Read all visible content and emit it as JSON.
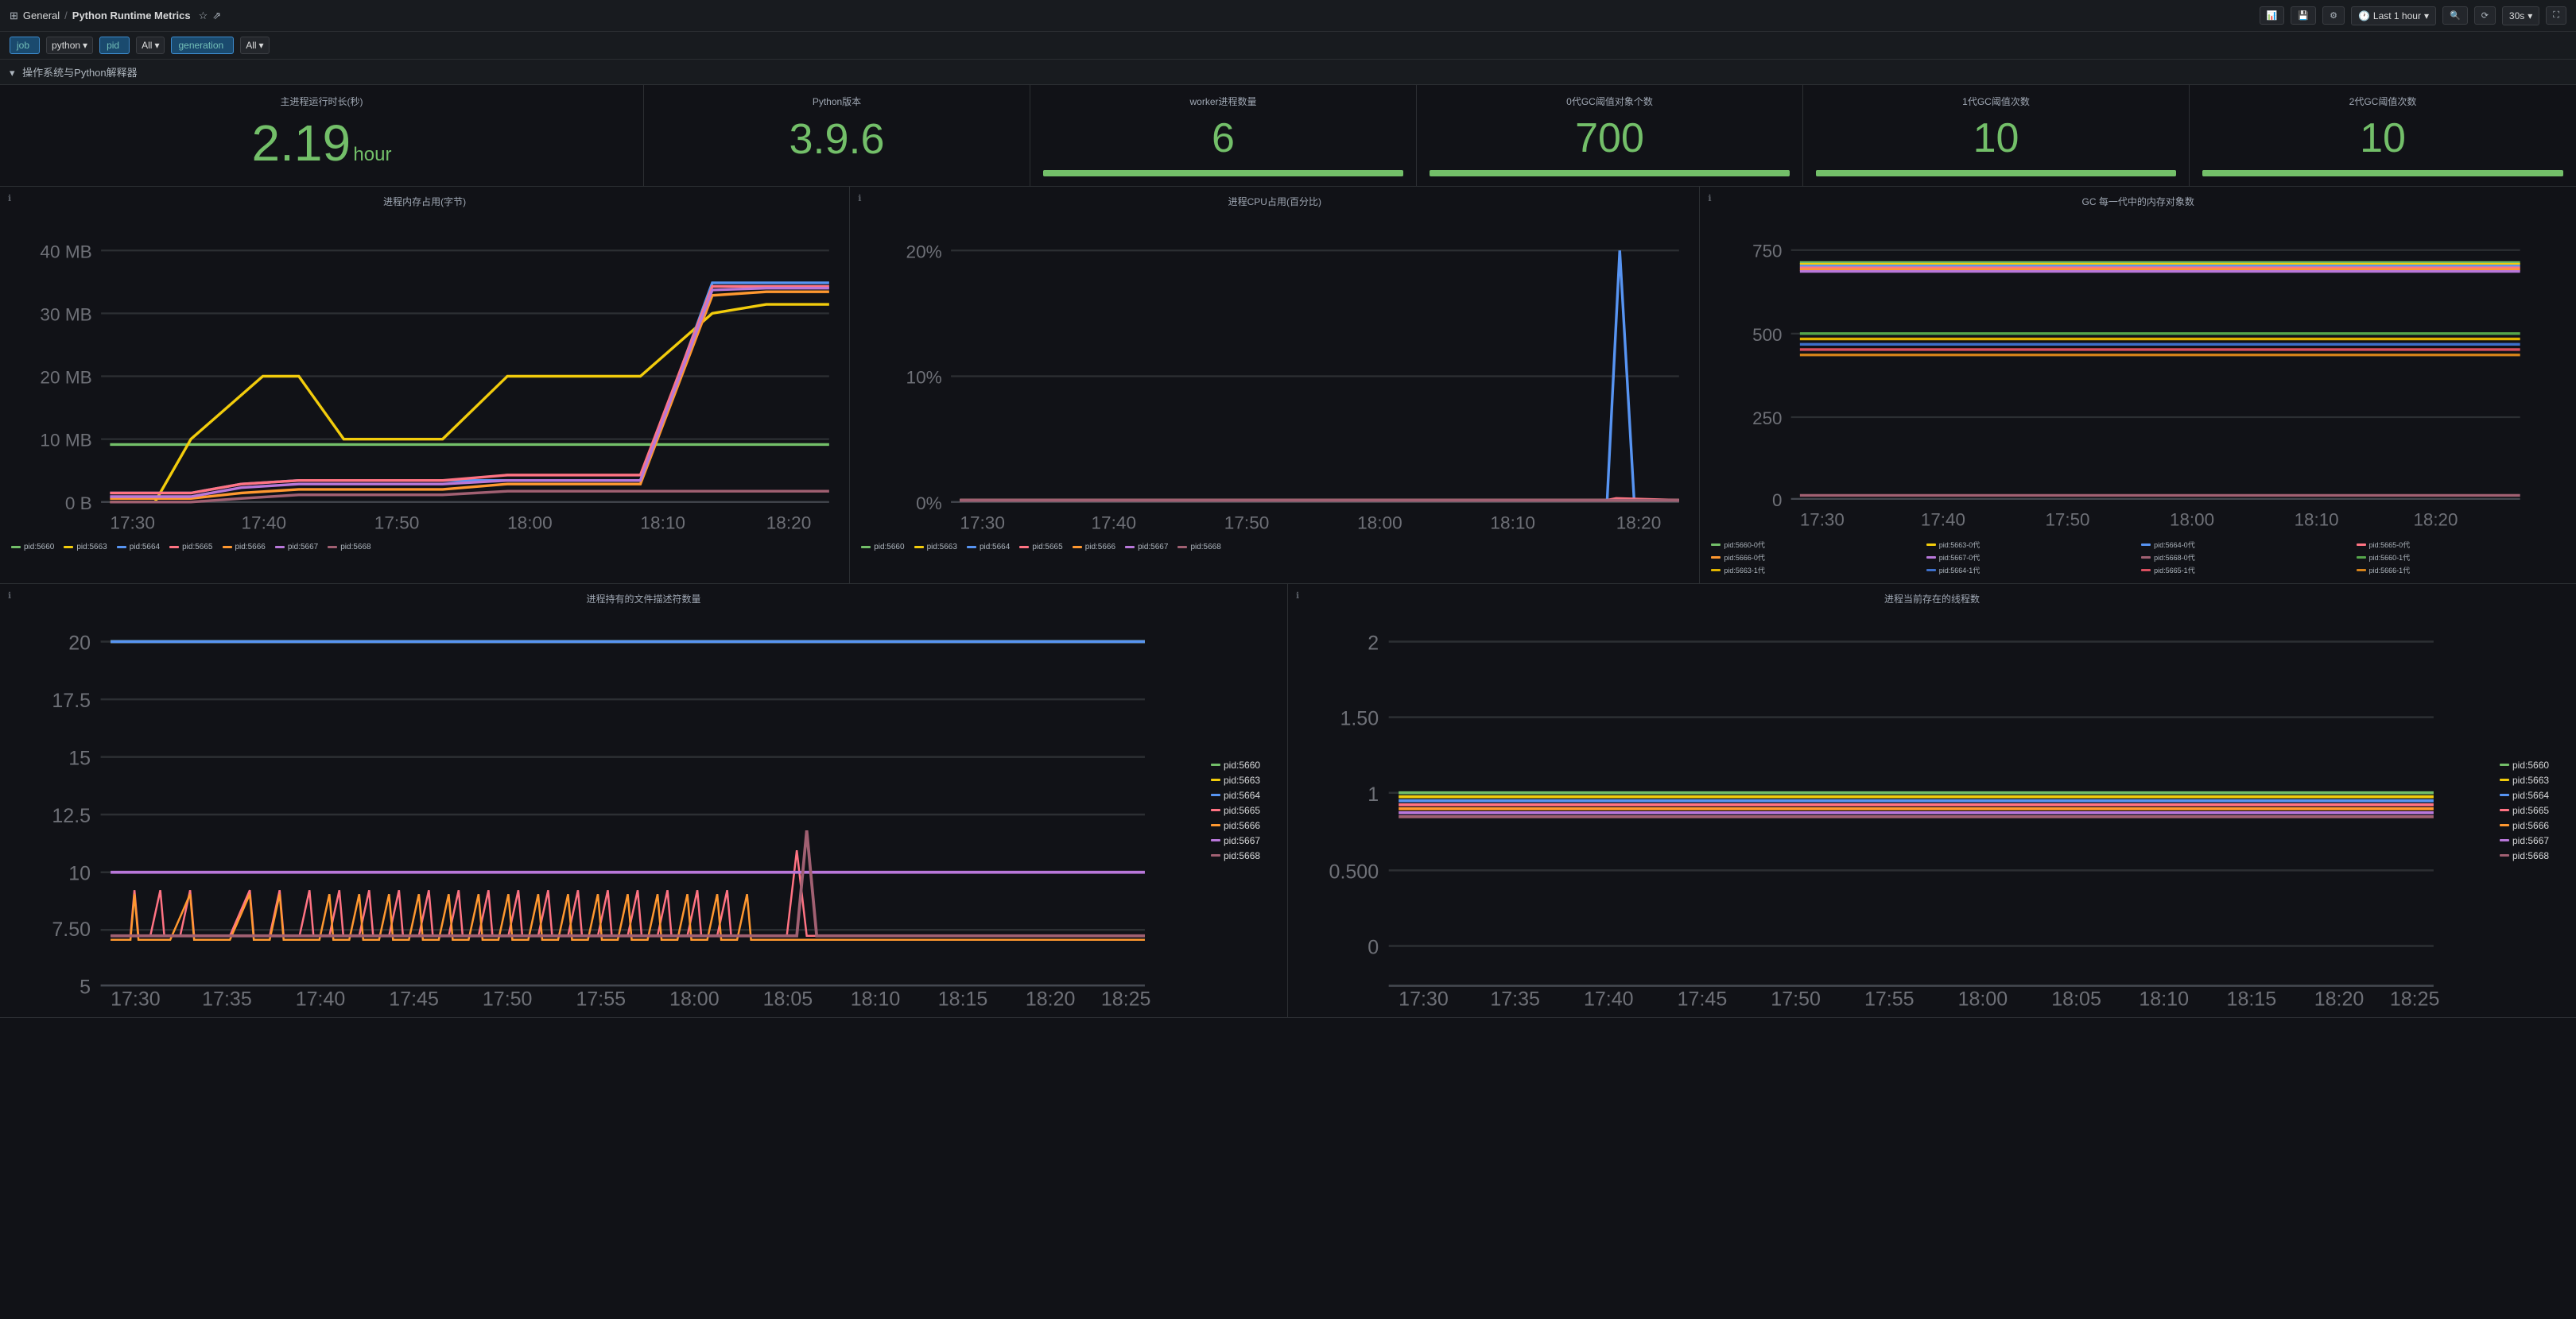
{
  "header": {
    "breadcrumb_home": "General",
    "separator": "/",
    "title": "Python Runtime Metrics",
    "time_label": "Last 1 hour",
    "refresh_label": "30s"
  },
  "filters": [
    {
      "key": "job",
      "value": "",
      "type": "key-only"
    },
    {
      "key": "python",
      "value": "",
      "type": "dropdown"
    },
    {
      "key": "pid",
      "value": "",
      "type": "key-only"
    },
    {
      "key": "All",
      "value": "",
      "type": "plain"
    },
    {
      "key": "generation",
      "value": "",
      "type": "key-only"
    },
    {
      "key": "All",
      "value": "",
      "type": "plain2"
    }
  ],
  "section_title": "操作系统与Python解释器",
  "stats": [
    {
      "label": "主进程运行时长(秒)",
      "value": "2.19",
      "unit": "hour",
      "bar": false
    },
    {
      "label": "Python版本",
      "value": "3.9.6",
      "unit": "",
      "bar": false
    },
    {
      "label": "worker进程数量",
      "value": "6",
      "unit": "",
      "bar": true,
      "bar_pct": 100
    },
    {
      "label": "0代GC阈值对象个数",
      "value": "700",
      "unit": "",
      "bar": true,
      "bar_pct": 100
    },
    {
      "label": "1代GC阈值次数",
      "value": "10",
      "unit": "",
      "bar": true,
      "bar_pct": 100
    },
    {
      "label": "2代GC阈值次数",
      "value": "10",
      "unit": "",
      "bar": true,
      "bar_pct": 100
    }
  ],
  "charts": [
    {
      "id": "mem",
      "title": "进程内存占用(字节)",
      "y_labels": [
        "40 MB",
        "30 MB",
        "20 MB",
        "10 MB",
        "0 B"
      ],
      "x_labels": [
        "17:30",
        "17:40",
        "17:50",
        "18:00",
        "18:10",
        "18:20"
      ],
      "legend": [
        {
          "label": "pid:5660",
          "color": "#73bf69"
        },
        {
          "label": "pid:5663",
          "color": "#f2cc0c"
        },
        {
          "label": "pid:5664",
          "color": "#5794f2"
        },
        {
          "label": "pid:5665",
          "color": "#ff7383"
        },
        {
          "label": "pid:5666",
          "color": "#ff9830"
        },
        {
          "label": "pid:5667",
          "color": "#b877d9"
        },
        {
          "label": "pid:5668",
          "color": "#a16072"
        }
      ]
    },
    {
      "id": "cpu",
      "title": "进程CPU占用(百分比)",
      "y_labels": [
        "20%",
        "10%",
        "0%"
      ],
      "x_labels": [
        "17:30",
        "17:40",
        "17:50",
        "18:00",
        "18:10",
        "18:20"
      ],
      "legend": [
        {
          "label": "pid:5660",
          "color": "#73bf69"
        },
        {
          "label": "pid:5663",
          "color": "#f2cc0c"
        },
        {
          "label": "pid:5664",
          "color": "#5794f2"
        },
        {
          "label": "pid:5665",
          "color": "#ff7383"
        },
        {
          "label": "pid:5666",
          "color": "#ff9830"
        },
        {
          "label": "pid:5667",
          "color": "#b877d9"
        },
        {
          "label": "pid:5668",
          "color": "#a16072"
        }
      ]
    },
    {
      "id": "gc",
      "title": "GC 每一代中的内存对象数",
      "y_labels": [
        "750",
        "500",
        "250",
        "0"
      ],
      "x_labels": [
        "17:30",
        "17:40",
        "17:50",
        "18:00",
        "18:10",
        "18:20"
      ],
      "legend": [
        {
          "label": "pid:5660-0代",
          "color": "#73bf69"
        },
        {
          "label": "pid:5663-0代",
          "color": "#f2cc0c"
        },
        {
          "label": "pid:5664-0代",
          "color": "#5794f2"
        },
        {
          "label": "pid:5665-0代",
          "color": "#ff7383"
        },
        {
          "label": "pid:5666-0代",
          "color": "#ff9830"
        },
        {
          "label": "pid:5667-0代",
          "color": "#b877d9"
        },
        {
          "label": "pid:5668-0代",
          "color": "#a16072"
        },
        {
          "label": "pid:5660-1代",
          "color": "#56a64b"
        },
        {
          "label": "pid:5663-1代",
          "color": "#e0b400"
        },
        {
          "label": "pid:5664-1代",
          "color": "#3d6fca"
        },
        {
          "label": "pid:5665-1代",
          "color": "#d94f5f"
        },
        {
          "label": "pid:5666-1代",
          "color": "#d4821a"
        }
      ]
    },
    {
      "id": "fd",
      "title": "进程持有的文件描述符数量",
      "y_labels": [
        "20",
        "17.5",
        "15",
        "12.5",
        "10",
        "7.50",
        "5"
      ],
      "x_labels": [
        "17:30",
        "17:35",
        "17:40",
        "17:45",
        "17:50",
        "17:55",
        "18:00",
        "18:05",
        "18:10",
        "18:15",
        "18:20",
        "18:25"
      ],
      "legend": [
        {
          "label": "pid:5660",
          "color": "#73bf69"
        },
        {
          "label": "pid:5663",
          "color": "#f2cc0c"
        },
        {
          "label": "pid:5664",
          "color": "#5794f2"
        },
        {
          "label": "pid:5665",
          "color": "#ff7383"
        },
        {
          "label": "pid:5666",
          "color": "#ff9830"
        },
        {
          "label": "pid:5667",
          "color": "#b877d9"
        },
        {
          "label": "pid:5668",
          "color": "#a16072"
        }
      ]
    },
    {
      "id": "threads",
      "title": "进程当前存在的线程数",
      "y_labels": [
        "2",
        "1.50",
        "1",
        "0.500",
        "0"
      ],
      "x_labels": [
        "17:30",
        "17:35",
        "17:40",
        "17:45",
        "17:50",
        "17:55",
        "18:00",
        "18:05",
        "18:10",
        "18:15",
        "18:20",
        "18:25"
      ],
      "legend": [
        {
          "label": "pid:5660",
          "color": "#73bf69"
        },
        {
          "label": "pid:5663",
          "color": "#f2cc0c"
        },
        {
          "label": "pid:5664",
          "color": "#5794f2"
        },
        {
          "label": "pid:5665",
          "color": "#ff7383"
        },
        {
          "label": "pid:5666",
          "color": "#ff9830"
        },
        {
          "label": "pid:5667",
          "color": "#b877d9"
        },
        {
          "label": "pid:5668",
          "color": "#a16072"
        }
      ]
    }
  ]
}
